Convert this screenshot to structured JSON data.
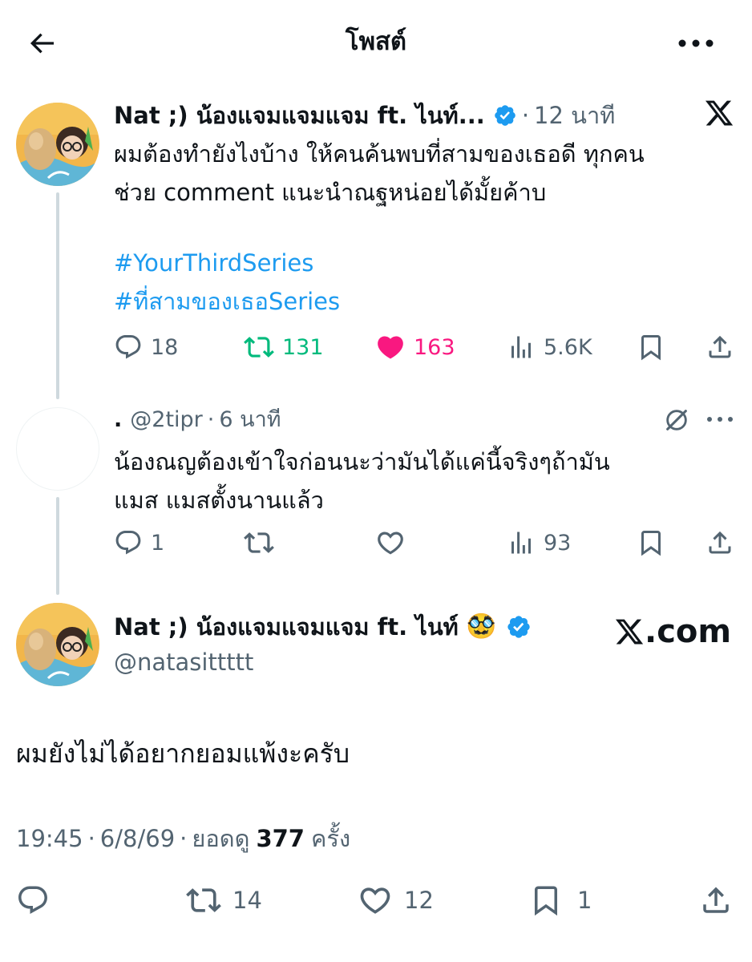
{
  "header": {
    "title": "โพสต์"
  },
  "parent_tweet": {
    "display_name": "Nat ;) น้องแจมแจมแจม ft. ไนท์...",
    "dot": "·",
    "time": "12 นาที",
    "text_line1": "ผมต้องทำยังไงบ้าง ให้คนค้นพบที่สามของเธอดี ทุกคน",
    "text_line2": "ช่วย comment แนะนำณฐหน่อยได้มั้ยค้าบ",
    "hashtags": [
      "#YourThirdSeries",
      "#ที่สามของเธอSeries"
    ],
    "stats": {
      "replies": "18",
      "reposts": "131",
      "likes": "163",
      "views": "5.6K"
    },
    "colors": {
      "repost": "#00ba7c",
      "like": "#f91880"
    }
  },
  "reply_tweet": {
    "display_name": ".",
    "handle": "@2tipr",
    "dot": "·",
    "time": "6 นาที",
    "text_line1": "น้องณญต้องเข้าใจก่อนนะว่ามันได้แค่นี้จริงๆถ้ามัน",
    "text_line2": "แมส  แมสตั้งนานแล้ว",
    "stats": {
      "replies": "1",
      "reposts": "",
      "likes": "",
      "views": "93"
    }
  },
  "main_tweet": {
    "display_name": "Nat ;) น้องแจมแจมแจม ft. ไนท์",
    "emoji": "🥸",
    "handle": "@natasittttt",
    "text": "ผมยังไม่ได้อยากยอมแพ้งะครับ",
    "meta": {
      "time": "19:45",
      "dot1": "·",
      "date": "6/8/69",
      "dot2": "·",
      "views_prefix": "ยอดดู",
      "views": "377",
      "views_suffix": "ครั้ง"
    },
    "stats": {
      "replies": "",
      "reposts": "14",
      "likes": "12",
      "bookmarks": "1"
    }
  },
  "watermark": {
    "text": ".com"
  },
  "icons": [
    "back-arrow-icon",
    "more-horizontal-icon",
    "verified-badge-icon",
    "x-logo-icon",
    "reply-icon",
    "repost-icon",
    "like-icon",
    "views-icon",
    "bookmark-icon",
    "share-icon",
    "grok-icon"
  ],
  "colors": {
    "text": "#0f1419",
    "muted": "#536471",
    "accent": "#1d9bf0",
    "line": "#cfd9de"
  }
}
